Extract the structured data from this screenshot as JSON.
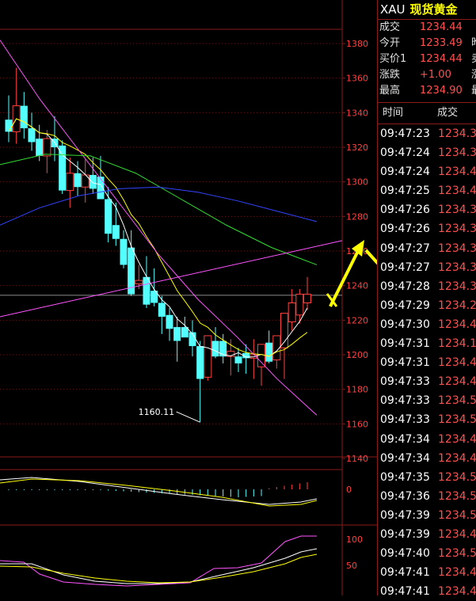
{
  "quote": {
    "symbol": "XAU",
    "name": "现货黄金",
    "rows": [
      {
        "label": "成交",
        "value": "1234.44",
        "extra": ""
      },
      {
        "label": "今开",
        "value": "1233.49",
        "extra": "昨"
      },
      {
        "label": "买价1",
        "value": "1234.44",
        "extra": "卖"
      },
      {
        "label": "涨跌",
        "value": "+1.00",
        "extra": "涨"
      },
      {
        "label": "最高",
        "value": "1234.90",
        "extra": "最"
      }
    ]
  },
  "ticks": {
    "header_time": "时间",
    "header_price": "成交",
    "rows": [
      {
        "time": "09:47:23",
        "price": "1234.3"
      },
      {
        "time": "09:47:24",
        "price": "1234.3"
      },
      {
        "time": "09:47:24",
        "price": "1234.4"
      },
      {
        "time": "09:47:25",
        "price": "1234.4"
      },
      {
        "time": "09:47:26",
        "price": "1234.3"
      },
      {
        "time": "09:47:26",
        "price": "1234.3"
      },
      {
        "time": "09:47:27",
        "price": "1234.3"
      },
      {
        "time": "09:47:27",
        "price": "1234.3"
      },
      {
        "time": "09:47:28",
        "price": "1234.3"
      },
      {
        "time": "09:47:29",
        "price": "1234.2"
      },
      {
        "time": "09:47:30",
        "price": "1234.4"
      },
      {
        "time": "09:47:31",
        "price": "1234.1"
      },
      {
        "time": "09:47:31",
        "price": "1234.4"
      },
      {
        "time": "09:47:33",
        "price": "1234.4"
      },
      {
        "time": "09:47:33",
        "price": "1234.5"
      },
      {
        "time": "09:47:33",
        "price": "1234.5"
      },
      {
        "time": "09:47:34",
        "price": "1234.4"
      },
      {
        "time": "09:47:34",
        "price": "1234.4"
      },
      {
        "time": "09:47:35",
        "price": "1234.5"
      },
      {
        "time": "09:47:36",
        "price": "1234.5"
      },
      {
        "time": "09:47:39",
        "price": "1234.5"
      },
      {
        "time": "09:47:39",
        "price": "1234.4"
      },
      {
        "time": "09:47:40",
        "price": "1234.5"
      },
      {
        "time": "09:47:41",
        "price": "1234.4"
      },
      {
        "time": "09:47:41",
        "price": "1234.4"
      }
    ]
  },
  "chart_data": {
    "type": "candlestick",
    "y_ticks": [
      1140,
      1160,
      1180,
      1200,
      1220,
      1240,
      1260,
      1280,
      1300,
      1320,
      1340,
      1360,
      1380
    ],
    "ylim": [
      1140,
      1384
    ],
    "low_annotation": "1160.11",
    "candles": [
      {
        "o": 1336,
        "h": 1350,
        "l": 1323,
        "c": 1329
      },
      {
        "o": 1329,
        "h": 1366,
        "l": 1322,
        "c": 1344
      },
      {
        "o": 1344,
        "h": 1352,
        "l": 1325,
        "c": 1331
      },
      {
        "o": 1331,
        "h": 1340,
        "l": 1318,
        "c": 1323
      },
      {
        "o": 1325,
        "h": 1333,
        "l": 1312,
        "c": 1315
      },
      {
        "o": 1315,
        "h": 1330,
        "l": 1305,
        "c": 1325
      },
      {
        "o": 1325,
        "h": 1338,
        "l": 1312,
        "c": 1320
      },
      {
        "o": 1321,
        "h": 1324,
        "l": 1293,
        "c": 1295
      },
      {
        "o": 1295,
        "h": 1314,
        "l": 1285,
        "c": 1305
      },
      {
        "o": 1305,
        "h": 1312,
        "l": 1292,
        "c": 1297
      },
      {
        "o": 1297,
        "h": 1313,
        "l": 1288,
        "c": 1304
      },
      {
        "o": 1304,
        "h": 1314,
        "l": 1293,
        "c": 1296
      },
      {
        "o": 1303,
        "h": 1315,
        "l": 1294,
        "c": 1290
      },
      {
        "o": 1290,
        "h": 1297,
        "l": 1265,
        "c": 1270
      },
      {
        "o": 1275,
        "h": 1288,
        "l": 1263,
        "c": 1267
      },
      {
        "o": 1267,
        "h": 1272,
        "l": 1250,
        "c": 1252
      },
      {
        "o": 1262,
        "h": 1272,
        "l": 1234,
        "c": 1235
      },
      {
        "o": 1241,
        "h": 1252,
        "l": 1238,
        "c": 1243
      },
      {
        "o": 1245,
        "h": 1257,
        "l": 1227,
        "c": 1229
      },
      {
        "o": 1237,
        "h": 1250,
        "l": 1228,
        "c": 1230
      },
      {
        "o": 1230,
        "h": 1234,
        "l": 1212,
        "c": 1222
      },
      {
        "o": 1223,
        "h": 1227,
        "l": 1208,
        "c": 1215
      },
      {
        "o": 1216,
        "h": 1222,
        "l": 1196,
        "c": 1208
      },
      {
        "o": 1216,
        "h": 1222,
        "l": 1212,
        "c": 1210
      },
      {
        "o": 1213,
        "h": 1220,
        "l": 1199,
        "c": 1205
      },
      {
        "o": 1205,
        "h": 1208,
        "l": 1161,
        "c": 1186
      },
      {
        "o": 1187,
        "h": 1209,
        "l": 1185,
        "c": 1211
      },
      {
        "o": 1208,
        "h": 1216,
        "l": 1198,
        "c": 1199
      },
      {
        "o": 1208,
        "h": 1212,
        "l": 1195,
        "c": 1199
      },
      {
        "o": 1199,
        "h": 1209,
        "l": 1188,
        "c": 1202
      },
      {
        "o": 1199,
        "h": 1204,
        "l": 1190,
        "c": 1195
      },
      {
        "o": 1201,
        "h": 1206,
        "l": 1189,
        "c": 1198
      },
      {
        "o": 1198,
        "h": 1209,
        "l": 1186,
        "c": 1200
      },
      {
        "o": 1193,
        "h": 1200,
        "l": 1182,
        "c": 1206
      },
      {
        "o": 1207,
        "h": 1214,
        "l": 1195,
        "c": 1196
      },
      {
        "o": 1197,
        "h": 1210,
        "l": 1192,
        "c": 1211
      },
      {
        "o": 1204,
        "h": 1218,
        "l": 1186,
        "c": 1224
      },
      {
        "o": 1219,
        "h": 1238,
        "l": 1214,
        "c": 1230
      },
      {
        "o": 1223,
        "h": 1238,
        "l": 1218,
        "c": 1235
      },
      {
        "o": 1230,
        "h": 1245,
        "l": 1226,
        "c": 1235
      }
    ],
    "macd_zero_label": "0",
    "kdj_labels": [
      "100",
      "50"
    ]
  }
}
